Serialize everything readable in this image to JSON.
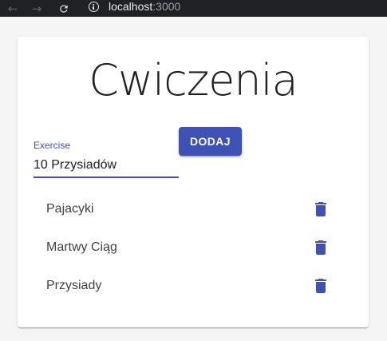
{
  "browser": {
    "url_host": "localhost",
    "url_port": ":3000"
  },
  "page": {
    "title": "Cwiczenia"
  },
  "form": {
    "label": "Exercise",
    "value": "10 Przysiadów",
    "add_label": "DODAJ"
  },
  "exercises": [
    {
      "name": "Pajacyki"
    },
    {
      "name": "Martwy Ciąg"
    },
    {
      "name": "Przysiady"
    }
  ],
  "colors": {
    "primary": "#3f51b5",
    "browser_bar": "#202124"
  },
  "icons": {
    "delete": "trash-icon",
    "back": "arrow-left-icon",
    "forward": "arrow-right-icon",
    "reload": "reload-icon",
    "info": "info-icon"
  }
}
